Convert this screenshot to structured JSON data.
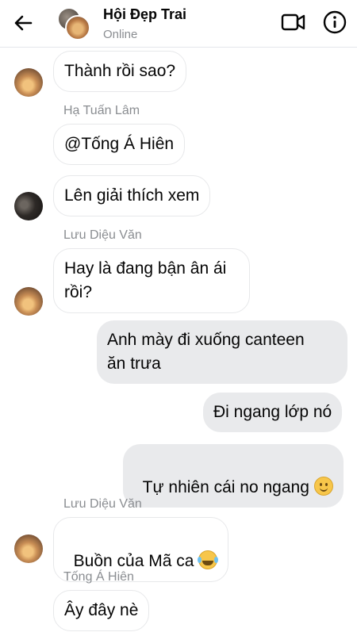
{
  "header": {
    "title": "Hội Đẹp Trai",
    "status": "Online",
    "back_icon": "back-arrow-icon",
    "video_icon": "video-camera-icon",
    "info_icon": "info-icon"
  },
  "messages": [
    {
      "direction": "incoming",
      "sender": "",
      "text": "Thành rồi sao?"
    },
    {
      "direction": "incoming",
      "sender": "Hạ Tuấn Lâm",
      "text": "@Tống Á Hiên"
    },
    {
      "direction": "incoming",
      "sender": "",
      "text": "Lên giải thích xem"
    },
    {
      "direction": "incoming",
      "sender": "Lưu Diệu Văn",
      "text": "Hay là đang bận ân ái\nrồi?"
    },
    {
      "direction": "outgoing",
      "sender": "",
      "text": "Anh mày đi xuống canteen\năn trưa"
    },
    {
      "direction": "outgoing",
      "sender": "",
      "text": "Đi ngang lớp nó"
    },
    {
      "direction": "outgoing",
      "sender": "",
      "text": "Tự nhiên cái no ngang",
      "emoji": "slightly-smiling-face-emoji"
    },
    {
      "direction": "incoming",
      "sender": "Lưu Diệu Văn",
      "text": "Buồn của Mã ca",
      "emoji": "tears-of-joy-emoji"
    },
    {
      "direction": "incoming",
      "sender": "Tống Á Hiên",
      "text": "Ây đây nè"
    }
  ],
  "colors": {
    "incoming_bubble": "#ffffff",
    "outgoing_bubble": "#e9eaec",
    "name_text": "#8a8d91",
    "text": "#050505"
  }
}
